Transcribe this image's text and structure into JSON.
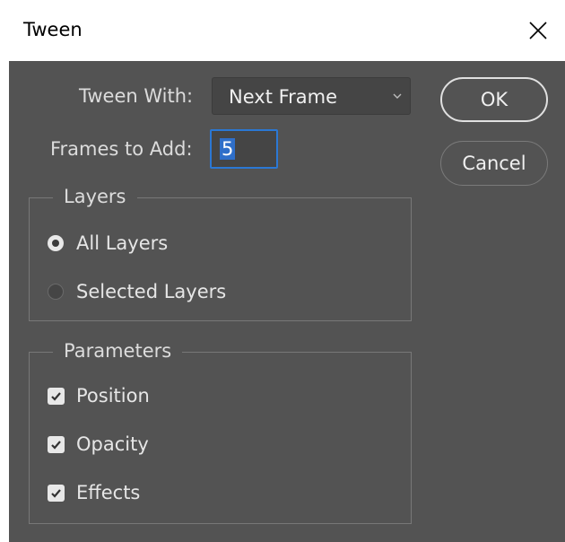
{
  "window": {
    "title": "Tween"
  },
  "form": {
    "tween_with_label": "Tween With:",
    "tween_with_value": "Next Frame",
    "frames_to_add_label": "Frames to Add:",
    "frames_to_add_value": "5"
  },
  "buttons": {
    "ok": "OK",
    "cancel": "Cancel"
  },
  "layers": {
    "legend": "Layers",
    "options": [
      {
        "label": "All Layers",
        "selected": true
      },
      {
        "label": "Selected Layers",
        "selected": false
      }
    ]
  },
  "parameters": {
    "legend": "Parameters",
    "options": [
      {
        "label": "Position",
        "checked": true
      },
      {
        "label": "Opacity",
        "checked": true
      },
      {
        "label": "Effects",
        "checked": true
      }
    ]
  },
  "colors": {
    "dialog_bg": "#535353",
    "focus_accent": "#2b78d4"
  }
}
